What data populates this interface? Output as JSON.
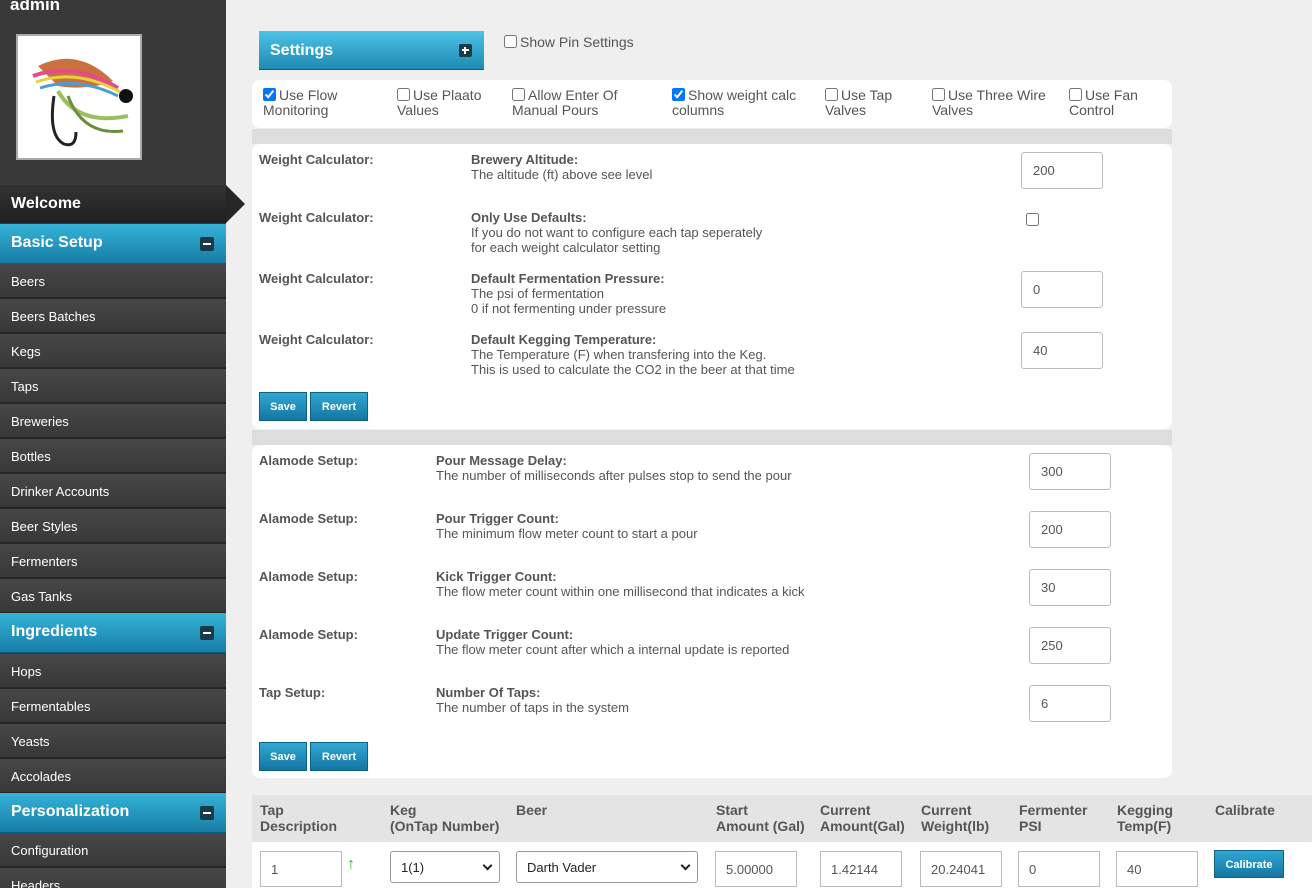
{
  "user": {
    "name": "admin"
  },
  "sidebar": {
    "welcome": "Welcome",
    "sections": [
      {
        "title": "Basic Setup",
        "items": [
          "Beers",
          "Beers Batches",
          "Kegs",
          "Taps",
          "Breweries",
          "Bottles",
          "Drinker Accounts",
          "Beer Styles",
          "Fermenters",
          "Gas Tanks"
        ]
      },
      {
        "title": "Ingredients",
        "items": [
          "Hops",
          "Fermentables",
          "Yeasts",
          "Accolades"
        ]
      },
      {
        "title": "Personalization",
        "items": [
          "Configuration",
          "Headers"
        ]
      }
    ]
  },
  "settings": {
    "title": "Settings",
    "show_pin_settings": "Show Pin Settings",
    "options": [
      {
        "label": "Use Flow Monitoring",
        "checked": true
      },
      {
        "label": "Use Plaato Values",
        "checked": false
      },
      {
        "label": "Allow Enter Of Manual Pours",
        "checked": false
      },
      {
        "label": "Show weight calc columns",
        "checked": true
      },
      {
        "label": "Use Tap Valves",
        "checked": false
      },
      {
        "label": "Use Three Wire Valves",
        "checked": false
      },
      {
        "label": "Use Fan Control",
        "checked": false
      }
    ]
  },
  "weight": {
    "rows": [
      {
        "label": "Weight Calculator:",
        "title": "Brewery Altitude:",
        "desc1": "The altitude (ft) above see level",
        "desc2": "",
        "value": "200"
      },
      {
        "label": "Weight Calculator:",
        "title": "Only Use Defaults:",
        "desc1": "If you do not want to configure each tap seperately",
        "desc2": "for each weight calculator setting",
        "value": ""
      },
      {
        "label": "Weight Calculator:",
        "title": "Default Fermentation Pressure:",
        "desc1": "The psi of fermentation",
        "desc2": "0 if not fermenting under pressure",
        "value": "0"
      },
      {
        "label": "Weight Calculator:",
        "title": "Default Kegging Temperature:",
        "desc1": "The Temperature (F) when transfering into the Keg.",
        "desc2": "This is used to calculate the CO2 in the beer at that time",
        "value": "40"
      }
    ],
    "save": "Save",
    "revert": "Revert"
  },
  "alamode": {
    "rows": [
      {
        "label": "Alamode Setup:",
        "title": "Pour Message Delay:",
        "desc": "The number of milliseconds after pulses stop to send the pour",
        "value": "300"
      },
      {
        "label": "Alamode Setup:",
        "title": "Pour Trigger Count:",
        "desc": "The minimum flow meter count to start a pour",
        "value": "200"
      },
      {
        "label": "Alamode Setup:",
        "title": "Kick Trigger Count:",
        "desc": "The flow meter count within one millisecond that indicates a kick",
        "value": "30"
      },
      {
        "label": "Alamode Setup:",
        "title": "Update Trigger Count:",
        "desc": "The flow meter count after which a internal update is reported",
        "value": "250"
      },
      {
        "label": "Tap Setup:",
        "title": "Number Of Taps:",
        "desc": "The number of taps in the system",
        "value": "6"
      }
    ],
    "save": "Save",
    "revert": "Revert"
  },
  "taps_table": {
    "headers": [
      [
        "Tap",
        "Description"
      ],
      [
        "Keg",
        "(OnTap Number)"
      ],
      [
        "Beer",
        ""
      ],
      [
        "Start",
        "Amount (Gal)"
      ],
      [
        "Current",
        "Amount(Gal)"
      ],
      [
        "Current",
        "Weight(lb)"
      ],
      [
        "Fermenter",
        "PSI"
      ],
      [
        "Kegging",
        "Temp(F)"
      ],
      [
        "Calibrate",
        ""
      ]
    ],
    "row": {
      "tap": "1",
      "keg": "1(1)",
      "beer": "Darth Vader",
      "start_amount": "5.00000",
      "current_amount": "1.42144",
      "current_weight": "20.24041",
      "fermenter_psi": "0",
      "kegging_temp": "40",
      "calibrate": "Calibrate"
    }
  },
  "icons": {
    "arrow_up": "↑"
  },
  "colors": {
    "accent": "#1e8ab2",
    "sidebar": "#393939"
  }
}
